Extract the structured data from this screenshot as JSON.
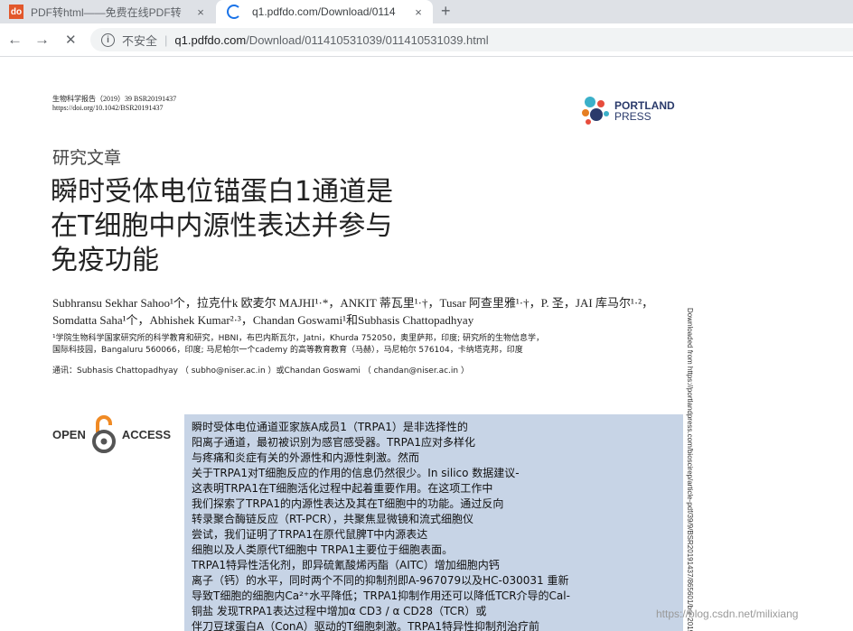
{
  "browser": {
    "tabs": [
      {
        "favicon": "do",
        "title": "PDF转html——免费在线PDF转",
        "close": "×"
      },
      {
        "title": "q1.pdfdo.com/Download/0114",
        "close": "×"
      }
    ],
    "new_tab": "+",
    "back": "←",
    "forward": "→",
    "stop": "✕",
    "security_label": "不安全",
    "url_host": "q1.pdfdo.com",
    "url_path": "/Download/011410531039/011410531039.html"
  },
  "doc": {
    "journal_line1": "生物科学报告（2019）39 BSR20191437",
    "journal_line2": "https://doi.org/10.1042/BSR20191437",
    "logo_line1": "PORTLAND",
    "logo_line2": "PRESS",
    "section": "研究文章",
    "title_lines": [
      "瞬时受体电位锚蛋白1通道是",
      "在T细胞中内源性表达并参与",
      "免疫功能"
    ],
    "authors_line1": "Subhransu Sekhar Sahoo¹个，拉克什k 欧麦尔 MAJHI¹·*，ANKIT 蒂瓦里¹·†，Tusar 阿查里雅¹·†，P. 圣，JAI 库马尔¹·²，",
    "authors_line2": "Somdatta Saha¹个，Abhishek Kumar²·³，Chandan    Goswami¹和Subhasis Chattopadhyay",
    "affil_line1": "¹学院生物科学国家研究所的科学教育和研究，HBNI，布巴内斯瓦尔，Jatni，Khurda 752050，奥里萨邦，印度; 研究所的生物信息学，",
    "affil_line2": "国际科技园，Bangaluru 560066，印度; 马尼帕尔一个cademy 的高等教育教育（马赫），马尼帕尔 576104，卡纳塔克邦，印度",
    "corr": "通讯：Subhasis Chattopadhyay （ subho@niser.ac.in ）或Chandan Goswami （ chandan@niser.ac.in ）",
    "oa_open": "OPEN",
    "oa_access": "ACCESS",
    "abstract_lines": [
      "瞬时受体电位通道亚家族A成员1（TRPA1）是非选择性的",
      "阳离子通道，最初被识别为感官感受器。TRPA1应对多样化",
      "与疼痛和炎症有关的外源性和内源性刺激。然而",
      "关于TRPA1对T细胞反应的作用的信息仍然很少。In silico 数据建议-",
      "这表明TRPA1在T细胞活化过程中起着重要作用。在这项工作中",
      "我们探索了TRPA1的内源性表达及其在T细胞中的功能。通过反向",
      "转录聚合酶链反应（RT-PCR），共聚焦显微镜和流式细胞仪",
      "尝试，我们证明了TRPA1在原代鼠脾T中内源表达",
      "细胞以及人类原代T细胞中 TRPA1主要位于细胞表面。",
      "TRPA1特异性活化剂，即异硫氰酸烯丙酯（AITC）增加细胞内钙",
      "离子（钙）的水平，同时两个不同的抑制剂即A-967079以及HC-030031 重新",
      "导致T细胞的细胞内Ca²⁺水平降低；TRPA1抑制作用还可以降低TCR介导的Cal-",
      "铜盐 发现TRPA1表达过程中增加α CD3 / α CD28（TCR）或",
      "伴刀豆球蛋白A（ConA）驱动的T细胞刺激。TRPA1特异性抑制剂治疗前"
    ],
    "sidenote": "Downloaded from https://portlandpress.com/bioscirep/article-pdf/39/9/BSR20191437/865601/bsr-20191437.pdf",
    "watermark": "https://blog.csdn.net/milixiang"
  }
}
